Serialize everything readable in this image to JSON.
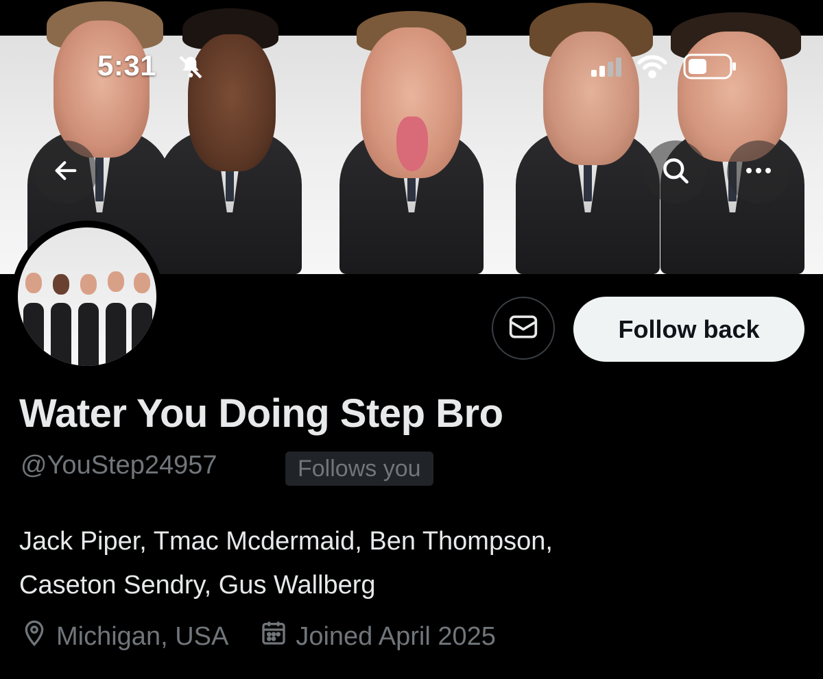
{
  "status_bar": {
    "time": "5:31",
    "icons": [
      "bell-muted-icon",
      "signal-icon",
      "wifi-icon",
      "battery-icon"
    ]
  },
  "header": {
    "back_icon": "arrow-left-icon",
    "search_icon": "search-icon",
    "more_icon": "more-horizontal-icon"
  },
  "profile": {
    "display_name": "Water You Doing Step Bro",
    "handle": "@YouStep24957",
    "follows_you_badge": "Follows you",
    "bio_line1": "Jack Piper, Tmac Mcdermaid, Ben Thompson,",
    "bio_line2": "Caseton Sendry, Gus Wallberg",
    "location": "Michigan, USA",
    "joined": "Joined April 2025"
  },
  "actions": {
    "message_icon": "envelope-icon",
    "follow_label": "Follow back"
  },
  "colors": {
    "background": "#000000",
    "primary_text": "#e7e9ea",
    "secondary_text": "#71767b",
    "button_bg": "#eff3f4",
    "badge_bg": "#202327"
  }
}
